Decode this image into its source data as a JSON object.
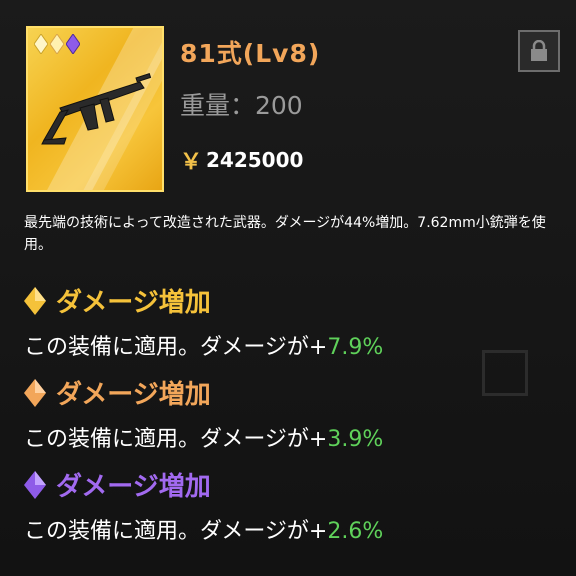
{
  "item": {
    "title": "81式(Lv8)",
    "weight": "重量：200",
    "price_symbol": "￥",
    "price": "2425000",
    "rarity_colors": [
      "#f5c23a",
      "#f5b84a",
      "#8e5be8"
    ]
  },
  "description": "最先端の技術によって改造された武器。ダメージが44%増加。7.62mm小銃弾を使用。",
  "effects": [
    {
      "name": "ダメージ増加",
      "gem_color": "#f5c23a",
      "name_color": "#f5c23a",
      "text": "この装備に適用。ダメージが+",
      "value": "7.9%"
    },
    {
      "name": "ダメージ増加",
      "gem_color": "#f2a65a",
      "name_color": "#f2a65a",
      "text": "この装備に適用。ダメージが+",
      "value": "3.9%"
    },
    {
      "name": "ダメージ増加",
      "gem_color": "#a26af0",
      "name_color": "#a26af0",
      "text": "この装備に適用。ダメージが+",
      "value": "2.6%"
    }
  ],
  "icons": {
    "lock": "lock-icon",
    "gem": "diamond-icon",
    "weapon": "rifle-icon"
  }
}
